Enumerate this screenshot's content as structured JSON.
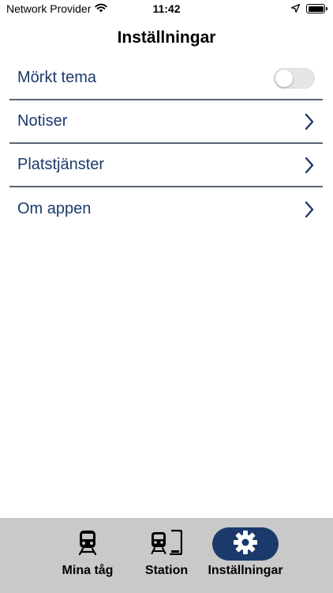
{
  "status_bar": {
    "carrier": "Network Provider",
    "time": "11:42"
  },
  "header": {
    "title": "Inställningar"
  },
  "settings": {
    "dark_theme": {
      "label": "Mörkt tema",
      "enabled": false
    },
    "items": [
      {
        "label": "Notiser",
        "icon": "chevron-right-icon"
      },
      {
        "label": "Platstjänster",
        "icon": "chevron-right-icon"
      },
      {
        "label": "Om appen",
        "icon": "chevron-right-icon"
      }
    ]
  },
  "tab_bar": {
    "tabs": [
      {
        "label": "Mina tåg",
        "icon": "train-icon",
        "active": false
      },
      {
        "label": "Station",
        "icon": "train-station-icon",
        "active": false
      },
      {
        "label": "Inställningar",
        "icon": "gear-icon",
        "active": true
      }
    ]
  },
  "colors": {
    "accent": "#1b3a6b",
    "divider": "#5a6473",
    "tab_bar_bg": "#c9c9c9",
    "toggle_off": "#e6e6e9"
  }
}
